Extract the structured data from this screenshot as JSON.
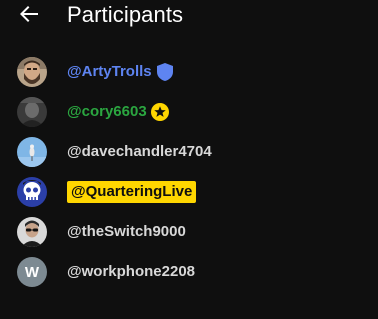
{
  "header": {
    "title": "Participants"
  },
  "participants": [
    {
      "name": "@ArtyTrolls",
      "role": "moderator",
      "badge": "shield-icon",
      "avatar": "photo-bearded-man"
    },
    {
      "name": "@cory6603",
      "role": "member",
      "badge": "star-badge-icon",
      "avatar": "photo-dark"
    },
    {
      "name": "@davechandler4704",
      "role": "viewer",
      "badge": null,
      "avatar": "photo-bird-sky"
    },
    {
      "name": "@QuarteringLive",
      "role": "owner",
      "badge": null,
      "avatar": "logo-skull-blue"
    },
    {
      "name": "@theSwitch9000",
      "role": "viewer",
      "badge": null,
      "avatar": "photo-person-glasses"
    },
    {
      "name": "@workphone2208",
      "role": "viewer",
      "badge": null,
      "avatar": "letter",
      "avatar_letter": "W"
    }
  ],
  "colors": {
    "background": "#0f0f0f",
    "moderator": "#5e84f1",
    "member": "#2ba640",
    "owner_highlight": "#ffd600",
    "default_name": "#d8d8d8"
  }
}
